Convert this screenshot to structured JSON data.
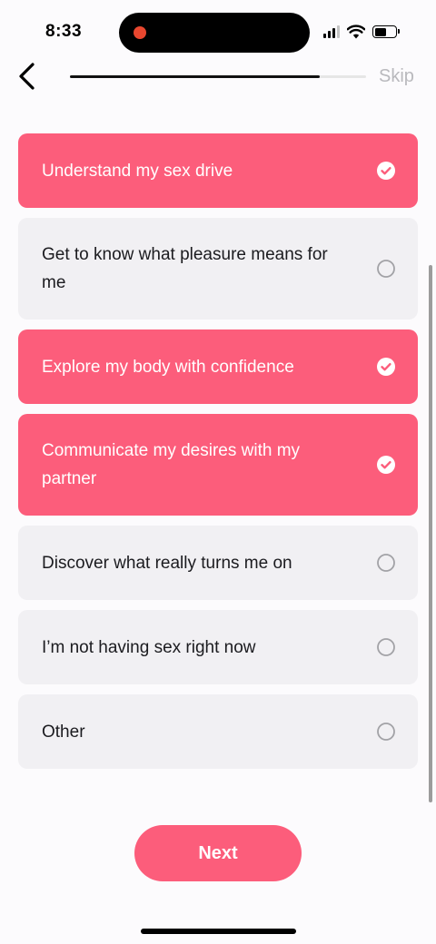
{
  "status_bar": {
    "time": "8:33",
    "recording": true,
    "wifi": true,
    "battery_level": 0.55
  },
  "nav": {
    "back_icon": "chevron-left-icon",
    "progress": 0.845,
    "skip_label": "Skip"
  },
  "options": [
    {
      "label": "Understand my sex drive",
      "selected": true
    },
    {
      "label": "Get to know what pleasure means for me",
      "selected": false
    },
    {
      "label": "Explore my body with confidence",
      "selected": true
    },
    {
      "label": "Communicate my desires with my partner",
      "selected": true
    },
    {
      "label": "Discover what really turns me on",
      "selected": false
    },
    {
      "label": "I’m not having sex right now",
      "selected": false
    },
    {
      "label": "Other",
      "selected": false
    }
  ],
  "next_label": "Next",
  "colors": {
    "accent": "#fc5d7b",
    "option_bg": "#f1f0f3",
    "text": "#1b1b1f"
  }
}
